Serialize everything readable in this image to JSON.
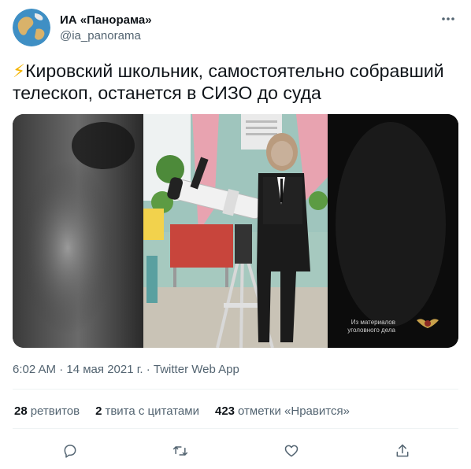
{
  "author": {
    "display_name": "ИА «Панорама»",
    "handle": "@ia_panorama"
  },
  "tweet": {
    "emoji": "⚡",
    "text": "Кировский школьник, самостоятельно собравший телескоп, останется в СИЗО до суда"
  },
  "media": {
    "watermark_line1": "Из материалов",
    "watermark_line2": "уголовного дела"
  },
  "meta": {
    "time": "6:02 AM",
    "separator": " · ",
    "date": "14 мая 2021 г.",
    "source": "Twitter Web App"
  },
  "stats": {
    "retweets_count": "28",
    "retweets_label": "ретвитов",
    "quotes_count": "2",
    "quotes_label": "твита с цитатами",
    "likes_count": "423",
    "likes_label": "отметки «Нравится»"
  },
  "icons": {
    "more": "more-icon",
    "reply": "reply-icon",
    "retweet": "retweet-icon",
    "like": "like-icon",
    "share": "share-icon"
  },
  "colors": {
    "text": "#0f1419",
    "secondary": "#536471",
    "lightning": "#f4b400"
  }
}
